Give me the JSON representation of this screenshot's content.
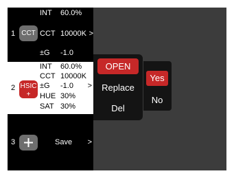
{
  "colors": {
    "accent": "#c62828",
    "screen_bg": "#3c3c3c",
    "panel_bg": "#000000"
  },
  "slots": [
    {
      "number": "1",
      "mode": "CCT",
      "fields": [
        {
          "label": "INT",
          "value": "60.0%"
        },
        {
          "label": "CCT",
          "value": "10000K"
        },
        {
          "label": "±G",
          "value": "-1.0"
        }
      ],
      "chevron": ">"
    },
    {
      "number": "2",
      "mode": "HSIC",
      "mode_sub": "+",
      "fields": [
        {
          "label": "INT",
          "value": "60.0%"
        },
        {
          "label": "CCT",
          "value": "10000K"
        },
        {
          "label": "±G",
          "value": "-1.0"
        },
        {
          "label": "HUE",
          "value": "30%"
        },
        {
          "label": "SAT",
          "value": "30%"
        }
      ],
      "chevron": ">"
    },
    {
      "number": "3",
      "add_icon": "plus-icon",
      "label": "Save",
      "chevron": ">"
    }
  ],
  "popup_menu": {
    "open": "OPEN",
    "replace": "Replace",
    "delete": "Del"
  },
  "confirm_menu": {
    "yes": "Yes",
    "no": "No"
  }
}
